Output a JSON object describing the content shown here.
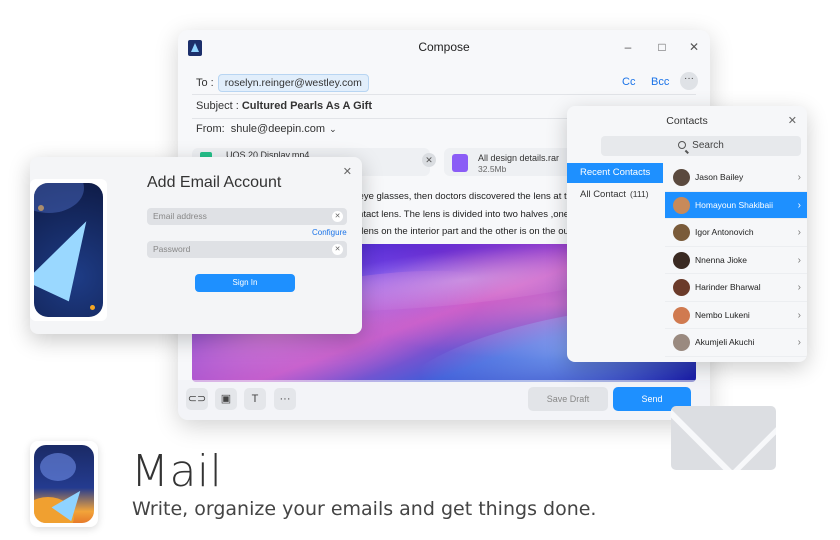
{
  "compose": {
    "title": "Compose",
    "controls": {
      "minimize": "–",
      "maximize": "□",
      "close": "✕"
    },
    "to_label": "To :",
    "to_recipient": "roselyn.reinger@westley.com",
    "cc_label": "Cc",
    "bcc_label": "Bcc",
    "more": "···",
    "subject_label": "Subject :",
    "subject_value": "Cultured Pearls As A Gift",
    "from_label": "From:",
    "from_value": "shule@deepin.com",
    "attachments": [
      {
        "name": "UOS 20 Display.mp4",
        "size": ""
      },
      {
        "name": "All design details.rar",
        "size": "32.5Mb"
      }
    ],
    "body_lines": [
      "of eye glasses, then doctors discovered the lens at the",
      "contact lens. The lens is divided into two halves ,one",
      "he lens on the interior part and the other is on the out"
    ],
    "save_draft": "Save Draft",
    "send": "Send",
    "tools": {
      "attach": "⊂⊃",
      "image": "▣",
      "text": "T",
      "more": "···"
    }
  },
  "contacts": {
    "title": "Contacts",
    "search_placeholder": "Search",
    "categories": [
      {
        "label": "Recent Contacts",
        "count": ""
      },
      {
        "label": "All Contact",
        "count": "(111)"
      }
    ],
    "people": [
      {
        "name": "Jason Bailey",
        "avatar_color": "#5b4a3f"
      },
      {
        "name": "Homayoun Shakibaii",
        "avatar_color": "#c88a5a"
      },
      {
        "name": "Igor Antonovich",
        "avatar_color": "#7a5b3a"
      },
      {
        "name": "Nnenna Jioke",
        "avatar_color": "#3a2a22"
      },
      {
        "name": "Harinder Bharwal",
        "avatar_color": "#6b3b2a"
      },
      {
        "name": "Nembo Lukeni",
        "avatar_color": "#d07a50"
      },
      {
        "name": "Akumjeli Akuchi",
        "avatar_color": "#9a8a80"
      }
    ],
    "selected_index": 1
  },
  "add_account": {
    "title": "Add Email Account",
    "email_placeholder": "Email address",
    "password_placeholder": "Password",
    "configure": "Configure",
    "sign_in": "Sign In"
  },
  "branding": {
    "app_name": "Mail",
    "tagline": "Write, organize your emails and get things done."
  },
  "colors": {
    "accent": "#1e90ff"
  }
}
